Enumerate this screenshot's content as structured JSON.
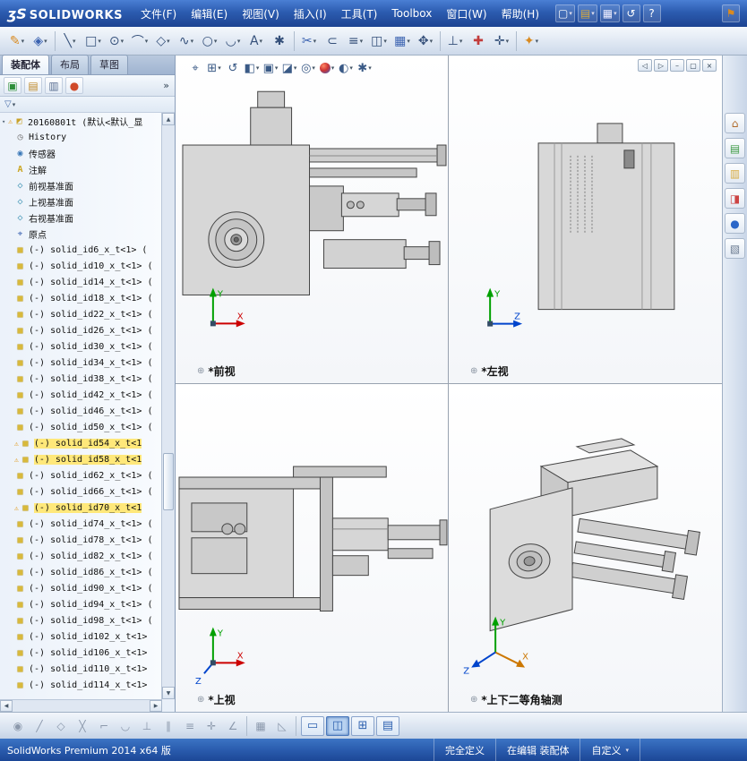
{
  "titlebar": {
    "logo_mark": "ʒS",
    "logo_text": "SOLIDWORKS",
    "menus": [
      {
        "label": "文件(F)"
      },
      {
        "label": "编辑(E)"
      },
      {
        "label": "视图(V)"
      },
      {
        "label": "插入(I)"
      },
      {
        "label": "工具(T)"
      },
      {
        "label": "Toolbox"
      },
      {
        "label": "窗口(W)"
      },
      {
        "label": "帮助(H)"
      }
    ],
    "quick_icons": [
      {
        "icon": "new-file-icon",
        "glyph": "▢",
        "dd": true
      },
      {
        "icon": "open-file-icon",
        "glyph": "▤",
        "cls": "g c-yellow",
        "dd": true
      },
      {
        "icon": "save-icon",
        "glyph": "▦",
        "cls": "g c-white",
        "dd": true
      },
      {
        "icon": "undo-icon",
        "glyph": "↺"
      },
      {
        "icon": "help-icon",
        "glyph": "?"
      }
    ],
    "right_icon": {
      "icon": "sw-resources-icon",
      "glyph": "⚑"
    }
  },
  "toolbar": {
    "icons": [
      {
        "icon": "sketch-icon",
        "glyph": "✎",
        "cls": "g c-orange",
        "dd": true
      },
      {
        "icon": "smart-dimension-icon",
        "glyph": "◈",
        "cls": "g c-blue",
        "dd": true
      },
      {
        "sep": true
      },
      {
        "icon": "line-icon",
        "glyph": "╲",
        "dd": true
      },
      {
        "icon": "rectangle-icon",
        "glyph": "□",
        "dd": true
      },
      {
        "icon": "circle-icon",
        "glyph": "⊙",
        "dd": true
      },
      {
        "icon": "arc-icon",
        "glyph": "⌒",
        "dd": true
      },
      {
        "icon": "polygon-icon",
        "glyph": "◇",
        "dd": true
      },
      {
        "icon": "spline-icon",
        "glyph": "∿",
        "dd": true
      },
      {
        "icon": "ellipse-icon",
        "glyph": "○",
        "dd": true
      },
      {
        "icon": "fillet-icon",
        "glyph": "◡",
        "dd": true
      },
      {
        "icon": "text-icon",
        "glyph": "A",
        "dd": true
      },
      {
        "icon": "point-icon",
        "glyph": "✱"
      },
      {
        "sep": true
      },
      {
        "icon": "trim-icon",
        "glyph": "✂",
        "cls": "g c-blue",
        "dd": true
      },
      {
        "icon": "convert-entities-icon",
        "glyph": "⊂"
      },
      {
        "icon": "offset-icon",
        "glyph": "≡",
        "dd": true
      },
      {
        "icon": "mirror-icon",
        "glyph": "◫",
        "dd": true
      },
      {
        "icon": "pattern-icon",
        "glyph": "▦",
        "cls": "g c-blue",
        "dd": true
      },
      {
        "icon": "move-entities-icon",
        "glyph": "✥",
        "dd": true
      },
      {
        "sep": true
      },
      {
        "icon": "display-relations-icon",
        "glyph": "⊥",
        "dd": true
      },
      {
        "icon": "repair-sketch-icon",
        "glyph": "✚",
        "cls": "g c-red"
      },
      {
        "icon": "quick-snaps-icon",
        "glyph": "✛",
        "dd": true
      },
      {
        "sep": true
      },
      {
        "icon": "options-icon",
        "glyph": "✦",
        "cls": "g c-orange",
        "dd": true
      }
    ]
  },
  "panel": {
    "tabs": [
      {
        "label": "装配体",
        "active": true
      },
      {
        "label": "布局"
      },
      {
        "label": "草图"
      }
    ],
    "head_icons": [
      {
        "icon": "featuremanager-tab-icon",
        "glyph": "▣",
        "cls": "phbtn p-green"
      },
      {
        "icon": "propertymanager-tab-icon",
        "glyph": "▤",
        "cls": "phbtn p-prop"
      },
      {
        "icon": "configurationmanager-tab-icon",
        "glyph": "▥",
        "cls": "phbtn p-config"
      },
      {
        "icon": "displaymanager-tab-icon",
        "glyph": "●",
        "cls": "phbtn p-ball"
      }
    ],
    "overflow_glyph": "»",
    "filter_glyph": "▽"
  },
  "tree": {
    "root": {
      "label": "20160801t (默认<默认_显",
      "icon": "assembly-icon",
      "glyph": "◩",
      "warn": true
    },
    "items": [
      {
        "label": "History",
        "icon": "history-folder-icon",
        "glyph": "◷",
        "cls": "ticon i-hist"
      },
      {
        "label": "传感器",
        "icon": "sensors-folder-icon",
        "glyph": "◉",
        "cls": "ticon i-sensor"
      },
      {
        "label": "注解",
        "icon": "annotations-folder-icon",
        "glyph": "A",
        "cls": "ticon i-ann"
      },
      {
        "label": "前视基准面",
        "icon": "front-plane-icon",
        "glyph": "◇",
        "cls": "ticon i-plane"
      },
      {
        "label": "上视基准面",
        "icon": "top-plane-icon",
        "glyph": "◇",
        "cls": "ticon i-plane"
      },
      {
        "label": "右视基准面",
        "icon": "right-plane-icon",
        "glyph": "◇",
        "cls": "ticon i-plane"
      },
      {
        "label": "原点",
        "icon": "origin-icon",
        "glyph": "⌖",
        "cls": "ticon i-origin"
      },
      {
        "label": "(-) solid_id6_x_t<1> (",
        "icon": "part-icon",
        "glyph": "■",
        "cls": "ticon i-solid"
      },
      {
        "label": "(-) solid_id10_x_t<1> (",
        "icon": "part-icon",
        "glyph": "■",
        "cls": "ticon i-solid"
      },
      {
        "label": "(-) solid_id14_x_t<1> (",
        "icon": "part-icon",
        "glyph": "■",
        "cls": "ticon i-solid"
      },
      {
        "label": "(-) solid_id18_x_t<1> (",
        "icon": "part-icon",
        "glyph": "■",
        "cls": "ticon i-solid"
      },
      {
        "label": "(-) solid_id22_x_t<1> (",
        "icon": "part-icon",
        "glyph": "■",
        "cls": "ticon i-solid"
      },
      {
        "label": "(-) solid_id26_x_t<1> (",
        "icon": "part-icon",
        "glyph": "■",
        "cls": "ticon i-solid"
      },
      {
        "label": "(-) solid_id30_x_t<1> (",
        "icon": "part-icon",
        "glyph": "■",
        "cls": "ticon i-solid"
      },
      {
        "label": "(-) solid_id34_x_t<1> (",
        "icon": "part-icon",
        "glyph": "■",
        "cls": "ticon i-solid"
      },
      {
        "label": "(-) solid_id38_x_t<1> (",
        "icon": "part-icon",
        "glyph": "■",
        "cls": "ticon i-solid"
      },
      {
        "label": "(-) solid_id42_x_t<1> (",
        "icon": "part-icon",
        "glyph": "■",
        "cls": "ticon i-solid"
      },
      {
        "label": "(-) solid_id46_x_t<1> (",
        "icon": "part-icon",
        "glyph": "■",
        "cls": "ticon i-solid"
      },
      {
        "label": "(-) solid_id50_x_t<1> (",
        "icon": "part-icon",
        "glyph": "■",
        "cls": "ticon i-solid"
      },
      {
        "label": "(-) solid_id54_x_t<1",
        "icon": "part-icon",
        "glyph": "■",
        "cls": "ticon i-solid",
        "warn": true,
        "hl": true
      },
      {
        "label": "(-) solid_id58_x_t<1",
        "icon": "part-icon",
        "glyph": "■",
        "cls": "ticon i-solid",
        "warn": true,
        "hl": true
      },
      {
        "label": "(-) solid_id62_x_t<1> (",
        "icon": "part-icon",
        "glyph": "■",
        "cls": "ticon i-solid"
      },
      {
        "label": "(-) solid_id66_x_t<1> (",
        "icon": "part-icon",
        "glyph": "■",
        "cls": "ticon i-solid"
      },
      {
        "label": "(-) solid_id70_x_t<1",
        "icon": "part-icon",
        "glyph": "■",
        "cls": "ticon i-solid",
        "warn": true,
        "hl": true
      },
      {
        "label": "(-) solid_id74_x_t<1> (",
        "icon": "part-icon",
        "glyph": "■",
        "cls": "ticon i-solid"
      },
      {
        "label": "(-) solid_id78_x_t<1> (",
        "icon": "part-icon",
        "glyph": "■",
        "cls": "ticon i-solid"
      },
      {
        "label": "(-) solid_id82_x_t<1> (",
        "icon": "part-icon",
        "glyph": "■",
        "cls": "ticon i-solid"
      },
      {
        "label": "(-) solid_id86_x_t<1> (",
        "icon": "part-icon",
        "glyph": "■",
        "cls": "ticon i-solid"
      },
      {
        "label": "(-) solid_id90_x_t<1> (",
        "icon": "part-icon",
        "glyph": "■",
        "cls": "ticon i-solid"
      },
      {
        "label": "(-) solid_id94_x_t<1> (",
        "icon": "part-icon",
        "glyph": "■",
        "cls": "ticon i-solid"
      },
      {
        "label": "(-) solid_id98_x_t<1> (",
        "icon": "part-icon",
        "glyph": "■",
        "cls": "ticon i-solid"
      },
      {
        "label": "(-) solid_id102_x_t<1>",
        "icon": "part-icon",
        "glyph": "■",
        "cls": "ticon i-solid"
      },
      {
        "label": "(-) solid_id106_x_t<1>",
        "icon": "part-icon",
        "glyph": "■",
        "cls": "ticon i-solid"
      },
      {
        "label": "(-) solid_id110_x_t<1>",
        "icon": "part-icon",
        "glyph": "■",
        "cls": "ticon i-solid"
      },
      {
        "label": "(-) solid_id114_x_t<1>",
        "icon": "part-icon",
        "glyph": "■",
        "cls": "ticon i-solid"
      }
    ]
  },
  "viewport": {
    "label_icon_glyph": "⊕",
    "panes": [
      {
        "label": "*前视"
      },
      {
        "label": "*左视"
      },
      {
        "label": "*上视"
      },
      {
        "label": "*上下二等角轴测"
      }
    ],
    "window_buttons": [
      {
        "icon": "pane-left-icon",
        "glyph": "◁"
      },
      {
        "icon": "pane-right-icon",
        "glyph": "▷"
      },
      {
        "icon": "minimize-window-icon",
        "glyph": "–"
      },
      {
        "icon": "restore-window-icon",
        "glyph": "▢"
      },
      {
        "icon": "close-window-icon",
        "glyph": "×"
      }
    ],
    "triad_labels": {
      "x": "X",
      "y": "Y",
      "z": "Z"
    }
  },
  "hud": {
    "icons": [
      {
        "icon": "zoom-fit-icon",
        "glyph": "⌖"
      },
      {
        "icon": "zoom-area-icon",
        "glyph": "⊞",
        "dd": true
      },
      {
        "icon": "previous-view-icon",
        "glyph": "↺"
      },
      {
        "icon": "section-view-icon",
        "glyph": "◧",
        "dd": true
      },
      {
        "icon": "view-orientation-icon",
        "glyph": "▣",
        "dd": true
      },
      {
        "icon": "display-style-icon",
        "glyph": "◪",
        "dd": true
      },
      {
        "icon": "hide-show-items-icon",
        "glyph": "◎",
        "dd": true
      },
      {
        "icon": "edit-appearance-icon",
        "ball": true,
        "dd": true
      },
      {
        "icon": "apply-scene-icon",
        "glyph": "◐",
        "dd": true
      },
      {
        "icon": "view-settings-icon",
        "glyph": "✱",
        "dd": true
      }
    ]
  },
  "taskpane": {
    "icons": [
      {
        "icon": "task-pane-home-icon",
        "glyph": "⌂",
        "cls": "taskbtn t-home"
      },
      {
        "icon": "design-library-icon",
        "glyph": "▤",
        "cls": "taskbtn t-lib"
      },
      {
        "icon": "file-explorer-icon",
        "glyph": "▥",
        "cls": "taskbtn t-folder"
      },
      {
        "icon": "view-palette-icon",
        "glyph": "◨",
        "cls": "taskbtn t-palette"
      },
      {
        "icon": "appearances-scenes-icon",
        "glyph": "●",
        "cls": "taskbtn t-globe"
      },
      {
        "icon": "custom-properties-icon",
        "glyph": "▧",
        "cls": "taskbtn t-props"
      }
    ]
  },
  "bottombar": {
    "icons": [
      {
        "icon": "snap-points-icon",
        "glyph": "◉"
      },
      {
        "icon": "snap-center-line-icon",
        "glyph": "╱"
      },
      {
        "icon": "snap-quadrant-icon",
        "glyph": "◇"
      },
      {
        "icon": "snap-intersection-icon",
        "glyph": "╳"
      },
      {
        "icon": "snap-nearest-icon",
        "glyph": "⌐"
      },
      {
        "icon": "snap-tangent-icon",
        "glyph": "◡"
      },
      {
        "icon": "snap-perpendicular-icon",
        "glyph": "⊥"
      },
      {
        "icon": "snap-parallel-icon",
        "glyph": "∥"
      },
      {
        "icon": "snap-hv-icon",
        "glyph": "≡"
      },
      {
        "icon": "snap-point-icon",
        "glyph": "✛"
      },
      {
        "icon": "snap-angle-icon",
        "glyph": "∠"
      },
      {
        "sep": true
      },
      {
        "icon": "grid-settings-icon",
        "glyph": "▦"
      },
      {
        "icon": "sketch-settings-icon",
        "glyph": "◺"
      },
      {
        "sep": true
      }
    ],
    "view_buttons": [
      {
        "icon": "viewport-single-button",
        "glyph": "▭"
      },
      {
        "icon": "viewport-two-button",
        "glyph": "◫",
        "active": true
      },
      {
        "icon": "viewport-four-button",
        "glyph": "⊞"
      },
      {
        "icon": "viewport-link-button",
        "glyph": "▤"
      }
    ]
  },
  "statusbar": {
    "app_version": "SolidWorks Premium 2014 x64 版",
    "define_state": "完全定义",
    "edit_state": "在编辑 装配体",
    "custom": "自定义"
  }
}
